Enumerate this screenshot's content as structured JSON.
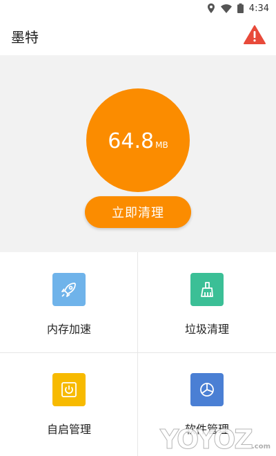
{
  "status_bar": {
    "time": "4:34",
    "icons": [
      "location-icon",
      "wifi-icon",
      "battery-icon"
    ]
  },
  "app_bar": {
    "title": "墨特",
    "warning_icon": "warning-icon"
  },
  "memory": {
    "value": "64.8",
    "unit": "MB"
  },
  "clean_button": {
    "label": "立即清理"
  },
  "features": [
    {
      "label": "内存加速",
      "icon": "rocket-icon",
      "color": "#6fb3ea"
    },
    {
      "label": "垃圾清理",
      "icon": "broom-icon",
      "color": "#3bbf96"
    },
    {
      "label": "自启管理",
      "icon": "power-icon",
      "color": "#f7ba00"
    },
    {
      "label": "软件管理",
      "icon": "pie-chart-icon",
      "color": "#4a7fd4"
    }
  ],
  "colors": {
    "accent": "#fb8c00",
    "hero_bg": "#f2f2f2",
    "warning": "#e84a3a"
  },
  "watermark": {
    "text": "YOYOZ",
    "suffix": ".com"
  }
}
